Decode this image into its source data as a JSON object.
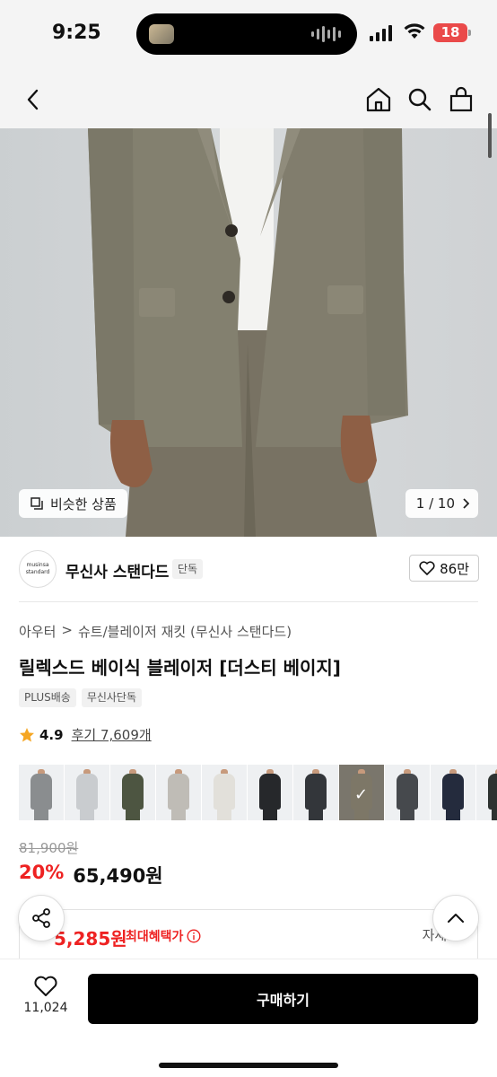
{
  "status_bar": {
    "time": "9:25",
    "battery": "18"
  },
  "top_nav": {
    "back_icon": "chevron-left-icon",
    "home_icon": "home-icon",
    "search_icon": "search-icon",
    "cart_icon": "shopping-bag-icon"
  },
  "gallery": {
    "similar_label": "비슷한 상품",
    "page_counter": "1 / 10"
  },
  "brand": {
    "logo_line1": "musinsa",
    "logo_line2": "standard",
    "name": "무신사 스탠다드",
    "exclusive_tag": "단독",
    "likes": "86만"
  },
  "breadcrumb": {
    "category": "아우터",
    "separator": ">",
    "subcategory": "슈트/블레이저 재킷 (무신사 스탠다드)"
  },
  "product": {
    "title": "릴렉스드 베이식 블레이저 [더스티 베이지]",
    "tags": [
      "PLUS배송",
      "무신사단독"
    ],
    "rating": "4.9",
    "review_link": "후기 7,609개",
    "original_price": "81,900원",
    "discount": "20%",
    "price": "65,490원"
  },
  "colors": [
    {
      "name": "gray",
      "hex": "#8a8d8f"
    },
    {
      "name": "light-gray",
      "hex": "#c9cccf"
    },
    {
      "name": "olive",
      "hex": "#4d5541"
    },
    {
      "name": "light-beige-gray",
      "hex": "#bfbcb6"
    },
    {
      "name": "ivory",
      "hex": "#e2e0da"
    },
    {
      "name": "black",
      "hex": "#26282b"
    },
    {
      "name": "charcoal",
      "hex": "#33363a"
    },
    {
      "name": "dusty-beige",
      "hex": "#7d7767",
      "selected": true
    },
    {
      "name": "dark-gray",
      "hex": "#46494d"
    },
    {
      "name": "navy",
      "hex": "#242b3d"
    },
    {
      "name": "dark-green",
      "hex": "#2e3331"
    },
    {
      "name": "black-2",
      "hex": "#1d1e20"
    }
  ],
  "benefit": {
    "price": "5,285원",
    "label": "최대혜택가",
    "detail": "자세히"
  },
  "bottom_bar": {
    "wish_count": "11,024",
    "buy_label": "구매하기"
  }
}
